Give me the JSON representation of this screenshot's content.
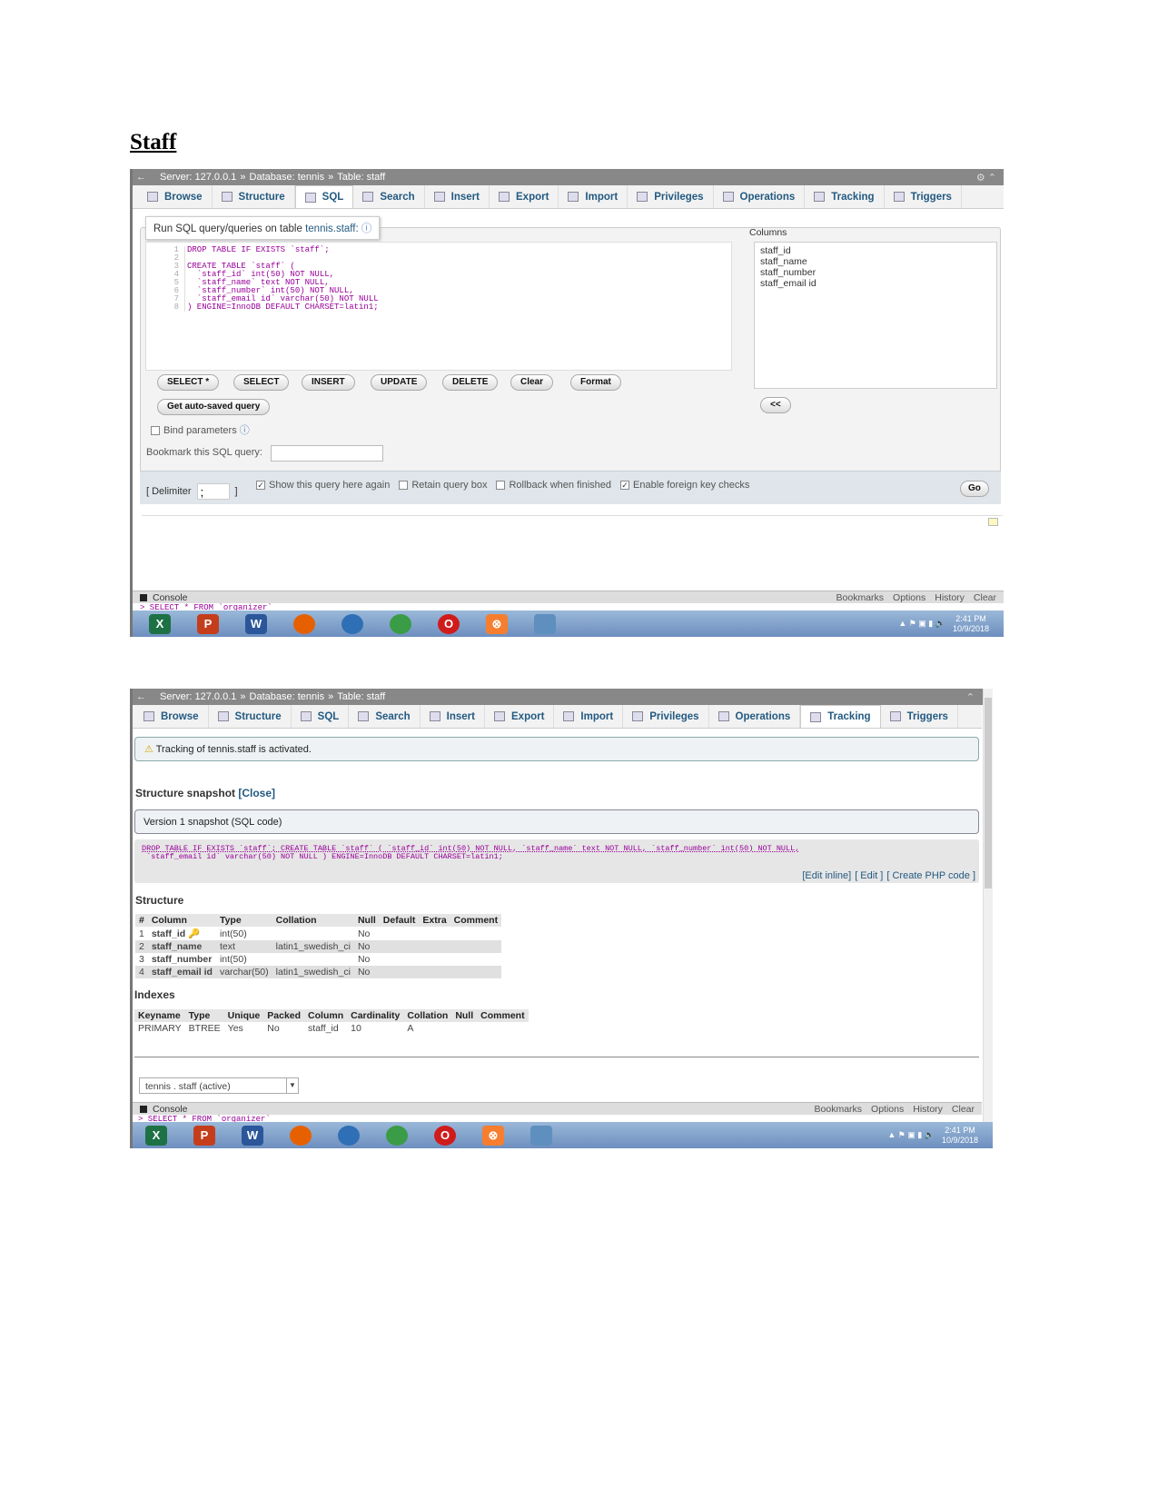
{
  "heading": "Staff",
  "shot1": {
    "breadcrumb": {
      "server": "Server: 127.0.0.1",
      "database": "Database: tennis",
      "table": "Table: staff",
      "sep": "»"
    },
    "tabs": [
      "Browse",
      "Structure",
      "SQL",
      "Search",
      "Insert",
      "Export",
      "Import",
      "Privileges",
      "Operations",
      "Tracking",
      "Triggers"
    ],
    "active_tab": "SQL",
    "legend": "Run SQL query/queries on table ",
    "legend_link": "tennis.staff:",
    "code_lines": [
      "DROP TABLE IF EXISTS `staff`;",
      "",
      "CREATE TABLE `staff` (",
      "  `staff_id` int(50) NOT NULL,",
      "  `staff_name` text NOT NULL,",
      "  `staff_number` int(50) NOT NULL,",
      "  `staff_email id` varchar(50) NOT NULL",
      ") ENGINE=InnoDB DEFAULT CHARSET=latin1;"
    ],
    "line_numbers": [
      "1",
      "2",
      "3",
      "4",
      "5",
      "6",
      "7",
      "8"
    ],
    "columns_label": "Columns",
    "columns": [
      "staff_id",
      "staff_name",
      "staff_number",
      "staff_email id"
    ],
    "buttons": [
      "SELECT *",
      "SELECT",
      "INSERT",
      "UPDATE",
      "DELETE",
      "Clear",
      "Format"
    ],
    "autosave": "Get auto-saved query",
    "insert_cols": "<<",
    "bind_params": "Bind parameters",
    "bookmark_label": "Bookmark this SQL query:",
    "bookmark_value": "",
    "delimiter_label": "[ Delimiter",
    "delimiter_value": ";",
    "delimiter_close": "]",
    "options": [
      {
        "label": "Show this query here again",
        "checked": true
      },
      {
        "label": "Retain query box",
        "checked": false
      },
      {
        "label": "Rollback when finished",
        "checked": false
      },
      {
        "label": "Enable foreign key checks",
        "checked": true
      }
    ],
    "go": "Go",
    "console": "Console",
    "console_links": [
      "Bookmarks",
      "Options",
      "History",
      "Clear"
    ],
    "console_text": "> SELECT * FROM `organizer`",
    "clock": {
      "time": "2:41 PM",
      "date": "10/9/2018"
    }
  },
  "shot2": {
    "breadcrumb": {
      "server": "Server: 127.0.0.1",
      "database": "Database: tennis",
      "table": "Table: staff",
      "sep": "»"
    },
    "tabs": [
      "Browse",
      "Structure",
      "SQL",
      "Search",
      "Insert",
      "Export",
      "Import",
      "Privileges",
      "Operations",
      "Tracking",
      "Triggers"
    ],
    "active_tab": "Tracking",
    "notice": "Tracking of tennis.staff is activated.",
    "snapshot_title": "Structure snapshot",
    "snapshot_close": "[Close]",
    "version": "Version 1 snapshot (SQL code)",
    "sql_line1": "DROP TABLE IF EXISTS `staff`; CREATE TABLE `staff` ( `staff_id` int(50) NOT NULL, `staff_name` text NOT NULL, `staff_number` int(50) NOT NULL,",
    "sql_line2": " `staff_email id` varchar(50) NOT NULL ) ENGINE=InnoDB DEFAULT CHARSET=latin1;",
    "sql_links": [
      "[Edit inline]",
      "[ Edit ]",
      "[ Create PHP code ]"
    ],
    "structure_title": "Structure",
    "structure_headers": [
      "#",
      "Column",
      "Type",
      "Collation",
      "Null",
      "Default",
      "Extra",
      "Comment"
    ],
    "structure_rows": [
      [
        "1",
        "staff_id",
        "int(50)",
        "",
        "No",
        "",
        "",
        ""
      ],
      [
        "2",
        "staff_name",
        "text",
        "latin1_swedish_ci",
        "No",
        "",
        "",
        ""
      ],
      [
        "3",
        "staff_number",
        "int(50)",
        "",
        "No",
        "",
        "",
        ""
      ],
      [
        "4",
        "staff_email id",
        "varchar(50)",
        "latin1_swedish_ci",
        "No",
        "",
        "",
        ""
      ]
    ],
    "indexes_title": "Indexes",
    "index_headers": [
      "Keyname",
      "Type",
      "Unique",
      "Packed",
      "Column",
      "Cardinality",
      "Collation",
      "Null",
      "Comment"
    ],
    "index_rows": [
      [
        "PRIMARY",
        "BTREE",
        "Yes",
        "No",
        "staff_id",
        "10",
        "A",
        "",
        ""
      ]
    ],
    "version_select": "tennis . staff (active)",
    "console": "Console",
    "console_links": [
      "Bookmarks",
      "Options",
      "History",
      "Clear"
    ],
    "console_text": "> SELECT * FROM `organizer`",
    "clock": {
      "time": "2:41 PM",
      "date": "10/9/2018"
    }
  },
  "taskbar_apps": [
    {
      "icon": "excel-icon",
      "glyph": "X",
      "color": "#1e7145"
    },
    {
      "icon": "powerpoint-icon",
      "glyph": "P",
      "color": "#c43e1c"
    },
    {
      "icon": "word-icon",
      "glyph": "W",
      "color": "#2b579a"
    },
    {
      "icon": "firefox-icon",
      "glyph": "",
      "color": "#e66000"
    },
    {
      "icon": "thunderbird-icon",
      "glyph": "",
      "color": "#2f6fb5"
    },
    {
      "icon": "chrome-icon",
      "glyph": "",
      "color": "#3a9c46"
    },
    {
      "icon": "opera-icon",
      "glyph": "O",
      "color": "#d01b1b"
    },
    {
      "icon": "xampp-icon",
      "glyph": "⊗",
      "color": "#f67e2e"
    },
    {
      "icon": "window-icon",
      "glyph": "",
      "color": "#5e8fbf"
    }
  ]
}
